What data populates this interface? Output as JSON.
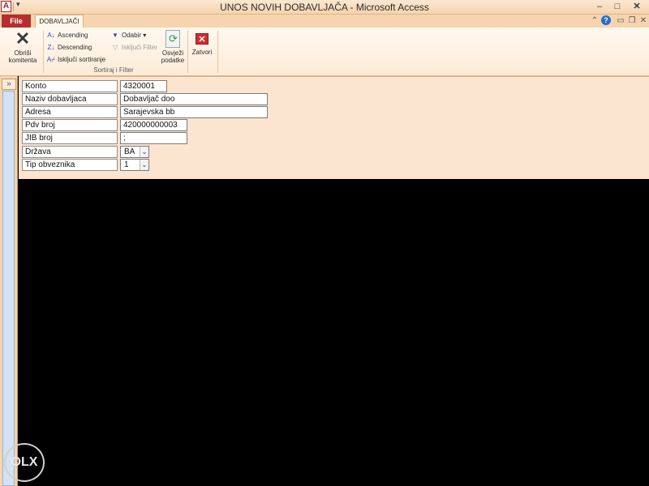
{
  "window": {
    "title": "UNOS NOVIH DOBAVLJAČA  -  Microsoft Access",
    "app_icon_letter": "A",
    "min": "–",
    "max": "□",
    "close": "✕"
  },
  "ribbon_tabs": {
    "file": "File",
    "active": "DOBAVLJAČI"
  },
  "ribbon_controls": {
    "collapse": "⌃",
    "help": "?",
    "min": "▭",
    "restore": "❐",
    "close": "✕"
  },
  "ribbon": {
    "delete_label_1": "Obriši",
    "delete_label_2": "komitenta",
    "ascending": "Ascending",
    "descending": "Descending",
    "clear_sort": "Isključi sortiranje",
    "selection": "Odabir ▾",
    "filter_off": "Isključi Filter",
    "refresh_label_1": "Osvježi",
    "refresh_label_2": "podatke",
    "close": "Zatvori",
    "group_label": "Sortiraj i Filter"
  },
  "nav": {
    "toggle": "»"
  },
  "form": {
    "fields": [
      {
        "label": "Konto",
        "value": "4320001"
      },
      {
        "label": "Naziv dobavljaca",
        "value": "Dobavljač doo"
      },
      {
        "label": "Adresa",
        "value": "Sarajevska bb"
      },
      {
        "label": "Pdv broj",
        "value": "420000000003"
      },
      {
        "label": "JIB broj",
        "value": ";"
      },
      {
        "label": "Država",
        "value": "BA"
      },
      {
        "label": "Tip obveznika",
        "value": "1"
      }
    ]
  },
  "watermark": {
    "text": "OLX"
  }
}
